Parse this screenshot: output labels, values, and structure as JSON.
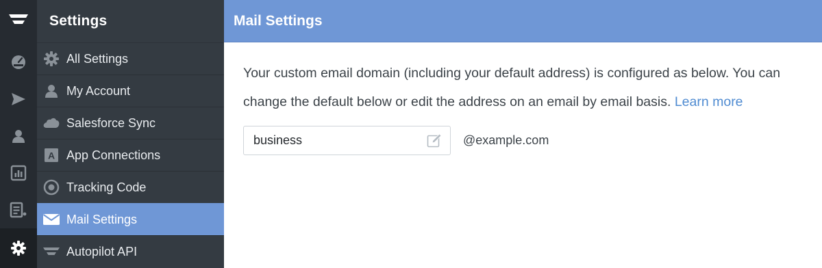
{
  "rail": {
    "items": [
      {
        "name": "logo-icon"
      },
      {
        "name": "dashboard-icon"
      },
      {
        "name": "send-icon"
      },
      {
        "name": "contacts-icon"
      },
      {
        "name": "reports-icon"
      },
      {
        "name": "lists-icon"
      },
      {
        "name": "settings-gear-icon",
        "active": true
      }
    ]
  },
  "sidebar": {
    "title": "Settings",
    "items": [
      {
        "label": "All Settings",
        "icon": "gear-icon"
      },
      {
        "label": "My Account",
        "icon": "person-icon"
      },
      {
        "label": "Salesforce Sync",
        "icon": "cloud-icon"
      },
      {
        "label": "App Connections",
        "icon": "app-a-icon"
      },
      {
        "label": "Tracking Code",
        "icon": "target-icon"
      },
      {
        "label": "Mail Settings",
        "icon": "envelope-icon",
        "active": true
      },
      {
        "label": "Autopilot API",
        "icon": "autopilot-logo-icon"
      }
    ]
  },
  "main": {
    "title": "Mail Settings",
    "description_line1": "Your custom email domain (including your default address) is configured as below. You can",
    "description_line2": "change the default below or edit the address on an email by email basis.",
    "learn_more": "Learn more",
    "address_local_value": "business",
    "address_domain": "@example.com"
  },
  "colors": {
    "accent": "#6f97d6",
    "rail_bg": "#262b31",
    "sidebar_bg": "#343b42",
    "link": "#4f8bd1"
  }
}
